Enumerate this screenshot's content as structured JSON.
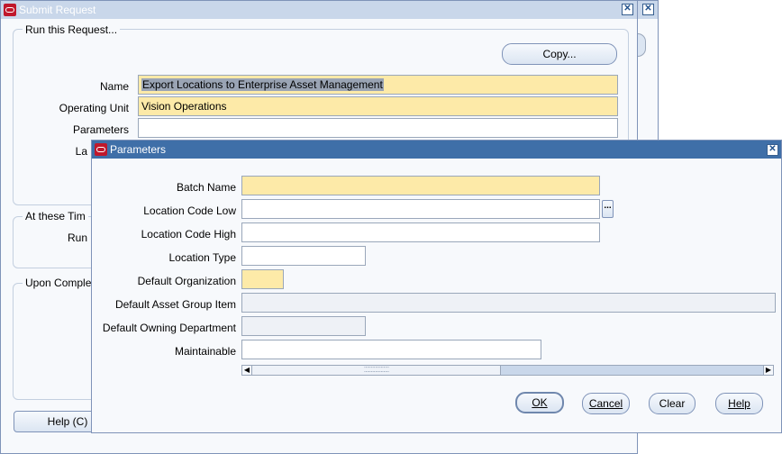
{
  "submit_request": {
    "title": "Submit Request",
    "group_run": "Run this Request...",
    "copy_button": "Copy...",
    "name_label": "Name",
    "name_value": "Export Locations to Enterprise Asset Management",
    "operating_unit_label": "Operating Unit",
    "operating_unit_value": "Vision Operations",
    "parameters_label": "Parameters",
    "parameters_value": "",
    "language_label_partial": "La",
    "group_times": "At these Tim",
    "run_label_partial": "Run",
    "group_completion": "Upon Comple",
    "help_button": "Help (C)"
  },
  "parameters_dialog": {
    "title": "Parameters",
    "fields": [
      {
        "label": "Batch Name",
        "value": ""
      },
      {
        "label": "Location Code Low",
        "value": ""
      },
      {
        "label": "Location Code High",
        "value": ""
      },
      {
        "label": "Location Type",
        "value": ""
      },
      {
        "label": "Default Organization",
        "value": ""
      },
      {
        "label": "Default Asset Group Item",
        "value": ""
      },
      {
        "label": "Default Owning Department",
        "value": ""
      },
      {
        "label": "Maintainable",
        "value": ""
      }
    ],
    "lov_button": "...",
    "buttons": {
      "ok": "OK",
      "cancel": "Cancel",
      "clear": "Clear",
      "help": "Help"
    }
  },
  "colors": {
    "title_active": "#3f6fa8",
    "title_inactive": "#c9d7ea",
    "required_field": "#fdeaa8",
    "window_bg": "#f7f9fc"
  }
}
